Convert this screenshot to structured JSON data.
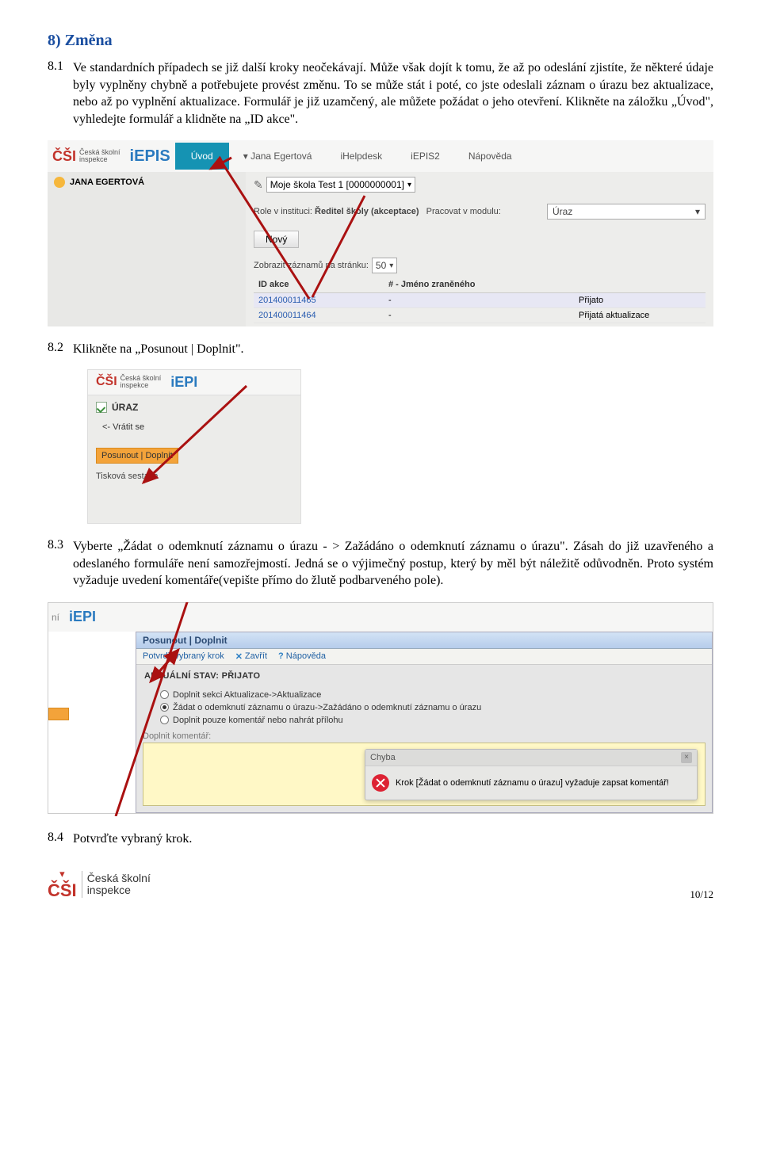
{
  "heading": "8)  Změna",
  "p81_num": "8.1",
  "p81_text": "Ve standardních případech se již další kroky neočekávají. Může však dojít k tomu, že až po odeslání zjistíte, že některé údaje byly vyplněny chybně a potřebujete provést změnu. To se může stát i poté, co jste odeslali záznam o úrazu bez aktualizace, nebo až po vyplnění aktualizace. Formulář je již uzamčený, ale můžete požádat o jeho otevření. Klikněte na záložku „Úvod\", vyhledejte formulář a klidněte na „ID akce\".",
  "shot1": {
    "csi": "ČŠI",
    "csi_sub1": "Česká školní",
    "csi_sub2": "inspekce",
    "iepis": "iEPIS",
    "tab_uvod": "Úvod",
    "user_menu": "Jana Egertová",
    "ihelpdesk": "iHelpdesk",
    "iepis2": "iEPIS2",
    "napoveda": "Nápověda",
    "user_name": "JANA EGERTOVÁ",
    "school_sel": "Moje škola Test 1 [0000000001]",
    "role_label": "Role v instituci:",
    "role_value": "Ředitel školy (akceptace)",
    "modul_label": "Pracovat v modulu:",
    "modul_value": "Úraz",
    "btn_novy": "Nový",
    "records_label": "Zobrazit záznamů na stránku:",
    "records_value": "50",
    "col_id": "ID akce",
    "col_name": "# - Jméno zraněného",
    "rows": [
      {
        "id": "201400011465",
        "dash": "-",
        "status": "Přijato"
      },
      {
        "id": "201400011464",
        "dash": "-",
        "status": "Přijatá aktualizace"
      }
    ]
  },
  "p82_num": "8.2",
  "p82_text": "Klikněte na „Posunout | Doplnit\".",
  "shot2": {
    "csi": "ČŠI",
    "csi_sub1": "Česká školní",
    "csi_sub2": "inspekce",
    "iepi": "iEPI",
    "uraz": "ÚRAZ",
    "back": "<- Vrátit se",
    "posun": "Posunout | Doplnit",
    "tisk": "Tisková sestava"
  },
  "p83_num": "8.3",
  "p83_text": "Vyberte „Žádat o odemknutí záznamu o úrazu - > Zažádáno o odemknutí záznamu o úrazu\". Zásah do již uzavřeného a odeslaného formuláře není samozřejmostí. Jedná se o výjimečný postup, který by měl být náležitě odůvodněn. Proto systém vyžaduje uvedení komentáře(vepište přímo do žlutě podbarveného pole).",
  "shot3": {
    "ni": "ní",
    "iepi": "iEPI",
    "title": "Posunout | Doplnit",
    "potvrdit": "Potvrdit vybraný krok",
    "zavrit": "Zavřít",
    "napoveda": "Nápověda",
    "stav": "AKTUÁLNÍ STAV: PŘIJATO",
    "opt1": "Doplnit sekci Aktualizace->Aktualizace",
    "opt2": "Žádat o odemknutí záznamu o úrazu->Zažádáno o odemknutí záznamu o úrazu",
    "opt3": "Doplnit pouze komentář nebo nahrát přílohu",
    "komentar_label": "Doplnit komentář:",
    "chyba_title": "Chyba",
    "chyba_msg": "Krok [Žádat o odemknutí záznamu o úrazu] vyžaduje zapsat komentář!"
  },
  "p84_num": "8.4",
  "p84_text": "Potvrďte vybraný krok.",
  "footer": {
    "csi": "ČŠI",
    "line1": "Česká školní",
    "line2": "inspekce",
    "page": "10/12"
  }
}
